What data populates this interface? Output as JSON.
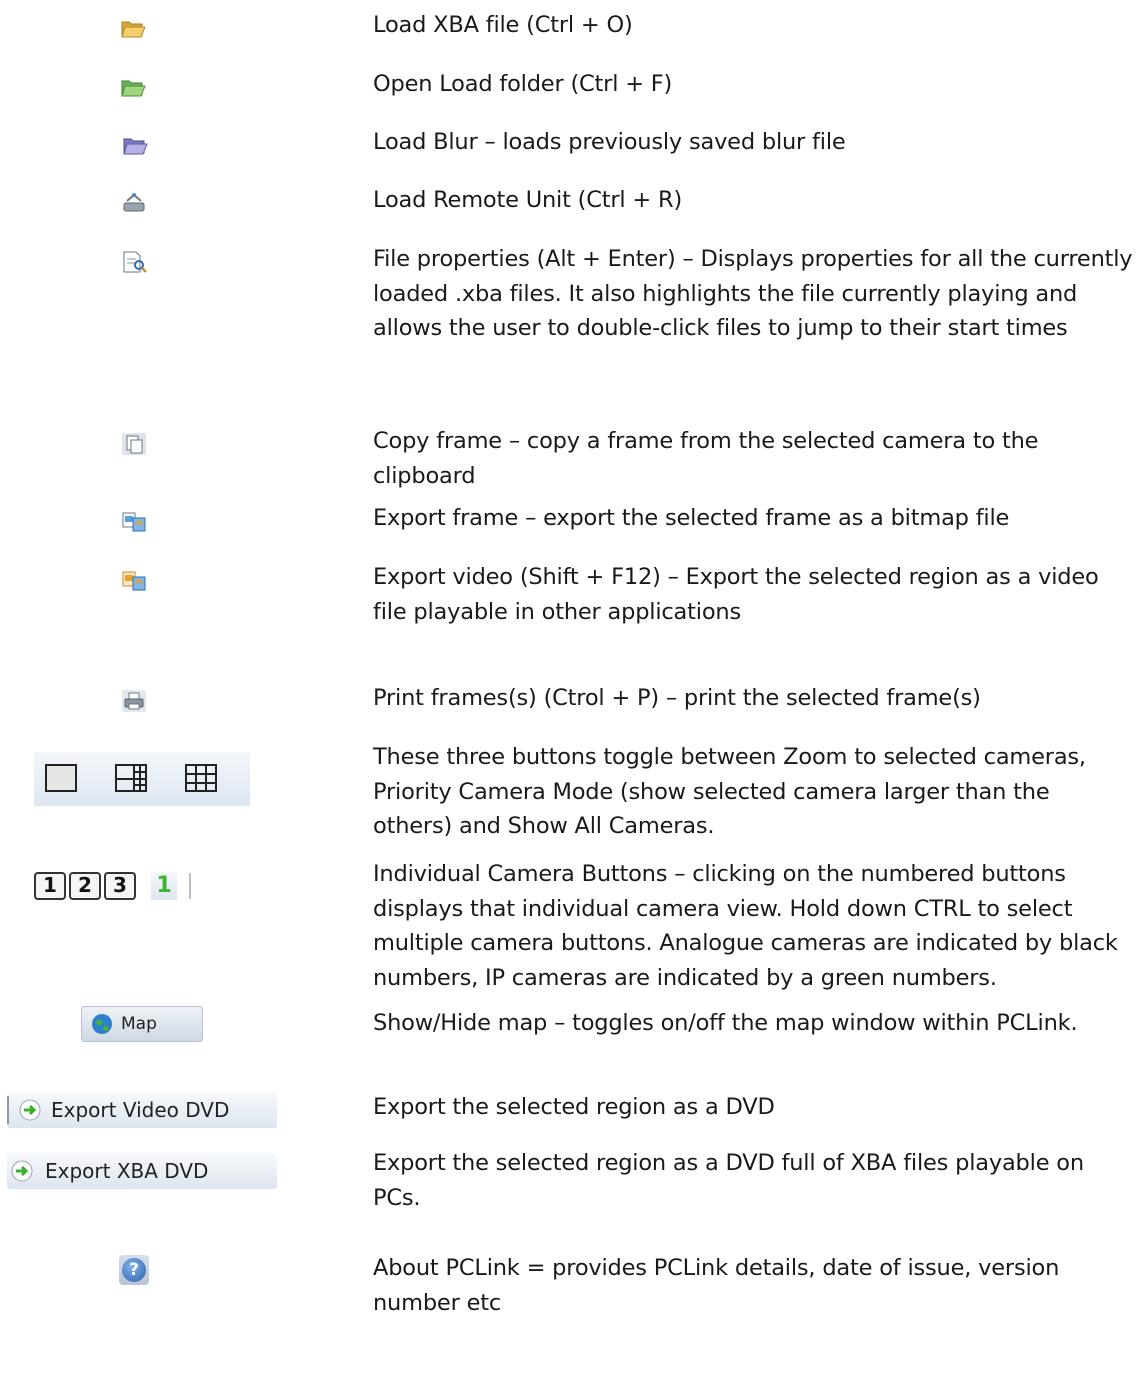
{
  "items": [
    {
      "icon": "folder-open-icon",
      "text": "Load XBA file (Ctrl + O)"
    },
    {
      "icon": "folder-open-green-icon",
      "text": "Open Load folder (Ctrl + F)"
    },
    {
      "icon": "folder-open-purple-icon",
      "text": "Load Blur – loads previously saved blur file"
    },
    {
      "icon": "remote-unit-icon",
      "text": "Load Remote Unit (Ctrl + R)"
    },
    {
      "icon": "file-properties-icon",
      "text": "File properties (Alt + Enter) – Displays properties for all the currently loaded .xba files. It also highlights the file currently playing and allows the user to double-click files to jump to their start times"
    },
    {
      "icon": "copy-frame-icon",
      "text": "Copy frame – copy a frame from the selected camera to the clipboard"
    },
    {
      "icon": "export-frame-icon",
      "text": "Export frame – export the selected frame as a bitmap file"
    },
    {
      "icon": "export-video-icon",
      "text": "Export video (Shift + F12) – Export the selected region as a video file playable in other applications"
    },
    {
      "icon": "printer-icon",
      "text": "Print frames(s) (Ctrol + P) – print the selected frame(s)"
    },
    {
      "icon": "layout-buttons-icon",
      "text": "These three buttons toggle between Zoom to selected cameras, Priority Camera Mode (show selected camera larger than the others) and Show All Cameras."
    },
    {
      "icon": "camera-number-buttons",
      "text": "Individual Camera Buttons – clicking on the numbered buttons displays that individual camera view.  Hold down CTRL to select multiple camera buttons. Analogue cameras are indicated by black numbers, IP cameras are indicated by a green numbers."
    },
    {
      "icon": "map-button",
      "text": "Show/Hide map – toggles on/off the map window within PCLink."
    },
    {
      "icon": "export-video-dvd-button",
      "text": "Export the selected region as a DVD"
    },
    {
      "icon": "export-xba-dvd-button",
      "text": "Export the selected region as a DVD full of XBA files playable on PCs."
    },
    {
      "icon": "help-icon",
      "text": "About PCLink = provides PCLink details, date of issue, version number etc"
    }
  ],
  "camera_buttons": {
    "analogue": [
      "1",
      "2",
      "3"
    ],
    "ip": [
      "1"
    ]
  },
  "buttons": {
    "map_label": "Map",
    "export_video_dvd_label": "Export Video DVD",
    "export_xba_dvd_label": "Export XBA DVD",
    "help_glyph": "?"
  },
  "colors": {
    "ip_number": "#3cb52c",
    "analogue_number": "#111111",
    "folder": "#e8b94a",
    "help": "#3f78c2"
  }
}
